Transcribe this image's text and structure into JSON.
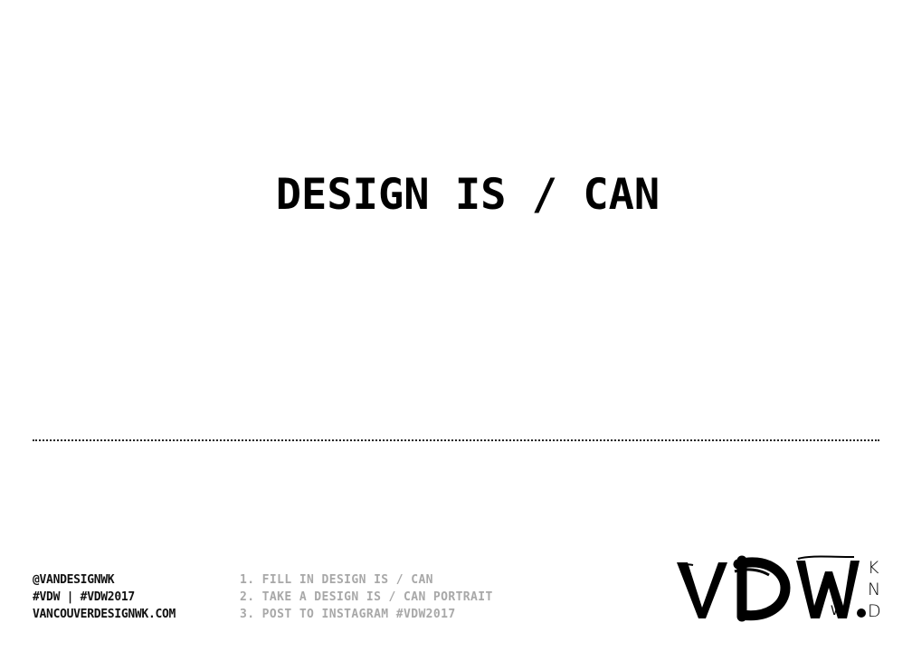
{
  "headline": "DESIGN IS / CAN",
  "social": {
    "handle": "@VANDESIGNWK",
    "hashtags": "#VDW | #VDW2017",
    "website": "VANCOUVERDESIGNWK.COM"
  },
  "steps": [
    "1. FILL IN DESIGN IS / CAN",
    "2. TAKE A DESIGN IS / CAN PORTRAIT",
    "3. POST TO INSTAGRAM #VDW2017"
  ],
  "logo": {
    "main": "VDW.",
    "stacked": [
      "K",
      "N",
      "D"
    ],
    "logo_icon": "vdw-wordmark"
  }
}
